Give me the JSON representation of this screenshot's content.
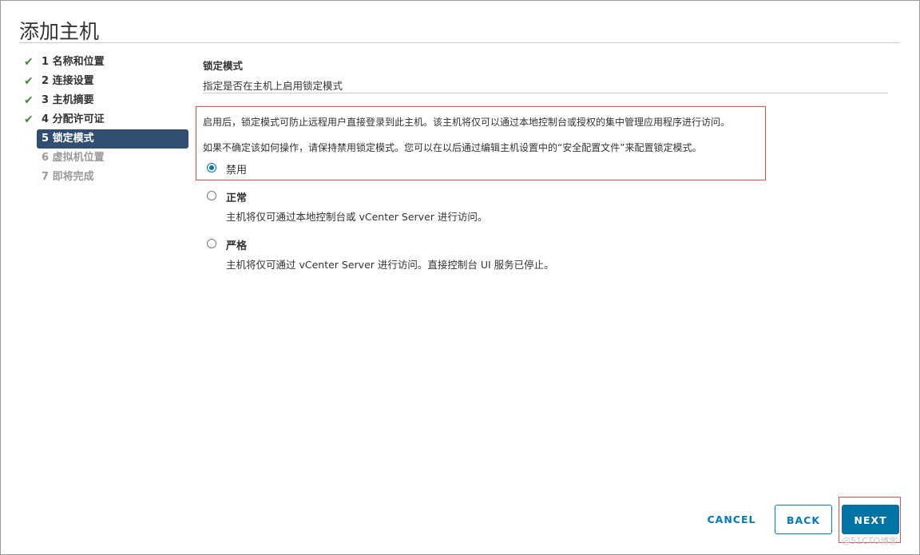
{
  "dialog": {
    "title": "添加主机"
  },
  "steps": [
    {
      "label": "1 名称和位置",
      "status": "completed"
    },
    {
      "label": "2 连接设置",
      "status": "completed"
    },
    {
      "label": "3 主机摘要",
      "status": "completed"
    },
    {
      "label": "4 分配许可证",
      "status": "completed"
    },
    {
      "label": "5 锁定模式",
      "status": "current"
    },
    {
      "label": "6 虚拟机位置",
      "status": "pending"
    },
    {
      "label": "7 即将完成",
      "status": "pending"
    }
  ],
  "section": {
    "title": "锁定模式",
    "subtitle": "指定是否在主机上启用锁定模式"
  },
  "info": {
    "line1": "启用后，锁定模式可防止远程用户直接登录到此主机。该主机将仅可以通过本地控制台或授权的集中管理应用程序进行访问。",
    "line2": "如果不确定该如何操作，请保持禁用锁定模式。您可以在以后通过编辑主机设置中的“安全配置文件”来配置锁定模式。"
  },
  "options": [
    {
      "label": "禁用",
      "description": "",
      "selected": true
    },
    {
      "label": "正常",
      "description": "主机将仅可通过本地控制台或 vCenter Server 进行访问。",
      "selected": false
    },
    {
      "label": "严格",
      "description": "主机将仅可通过 vCenter Server 进行访问。直接控制台 UI 服务已停止。",
      "selected": false
    }
  ],
  "buttons": {
    "cancel": "CANCEL",
    "back": "BACK",
    "next": "NEXT"
  },
  "watermark": "@51CTO博客",
  "colors": {
    "accent": "#0072a3",
    "current_step_bg": "#314d6f",
    "check": "#3a8a35",
    "highlight": "#d9534f"
  }
}
